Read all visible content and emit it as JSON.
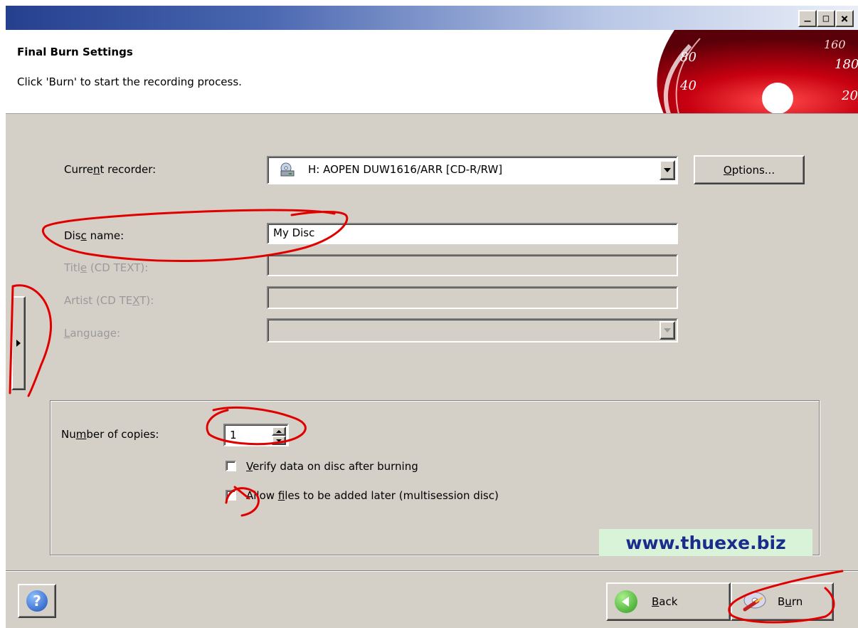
{
  "window": {
    "minimize": "_",
    "maximize": "□",
    "close": "×"
  },
  "header": {
    "title": "Final Burn Settings",
    "subtitle": "Click 'Burn' to start the recording process.",
    "gauge_numbers": [
      "160",
      "80",
      "180",
      "40",
      "20",
      "20"
    ]
  },
  "form": {
    "recorder_label": "Current recorder:",
    "recorder_value": "H: AOPEN DUW1616/ARR   [CD-R/RW]",
    "options_button": "Options...",
    "disc_name_label": "Disc name:",
    "disc_name_value": "My Disc",
    "title_label": "Title (CD TEXT):",
    "artist_label": "Artist (CD TEXT):",
    "language_label": "Language:"
  },
  "copies": {
    "label": "Number of copies:",
    "value": "1",
    "verify_label": "Verify data on disc after burning",
    "multisession_label": "Allow files to be added later (multisession disc)"
  },
  "watermark": "www.thuexe.biz",
  "footer": {
    "help_icon": "?",
    "back_label": "Back",
    "burn_label": "Burn"
  },
  "colors": {
    "face": "#d4d0c8",
    "title_blue": "#24408f",
    "annotation_red": "#e00000",
    "gauge_red": "#c80010"
  }
}
